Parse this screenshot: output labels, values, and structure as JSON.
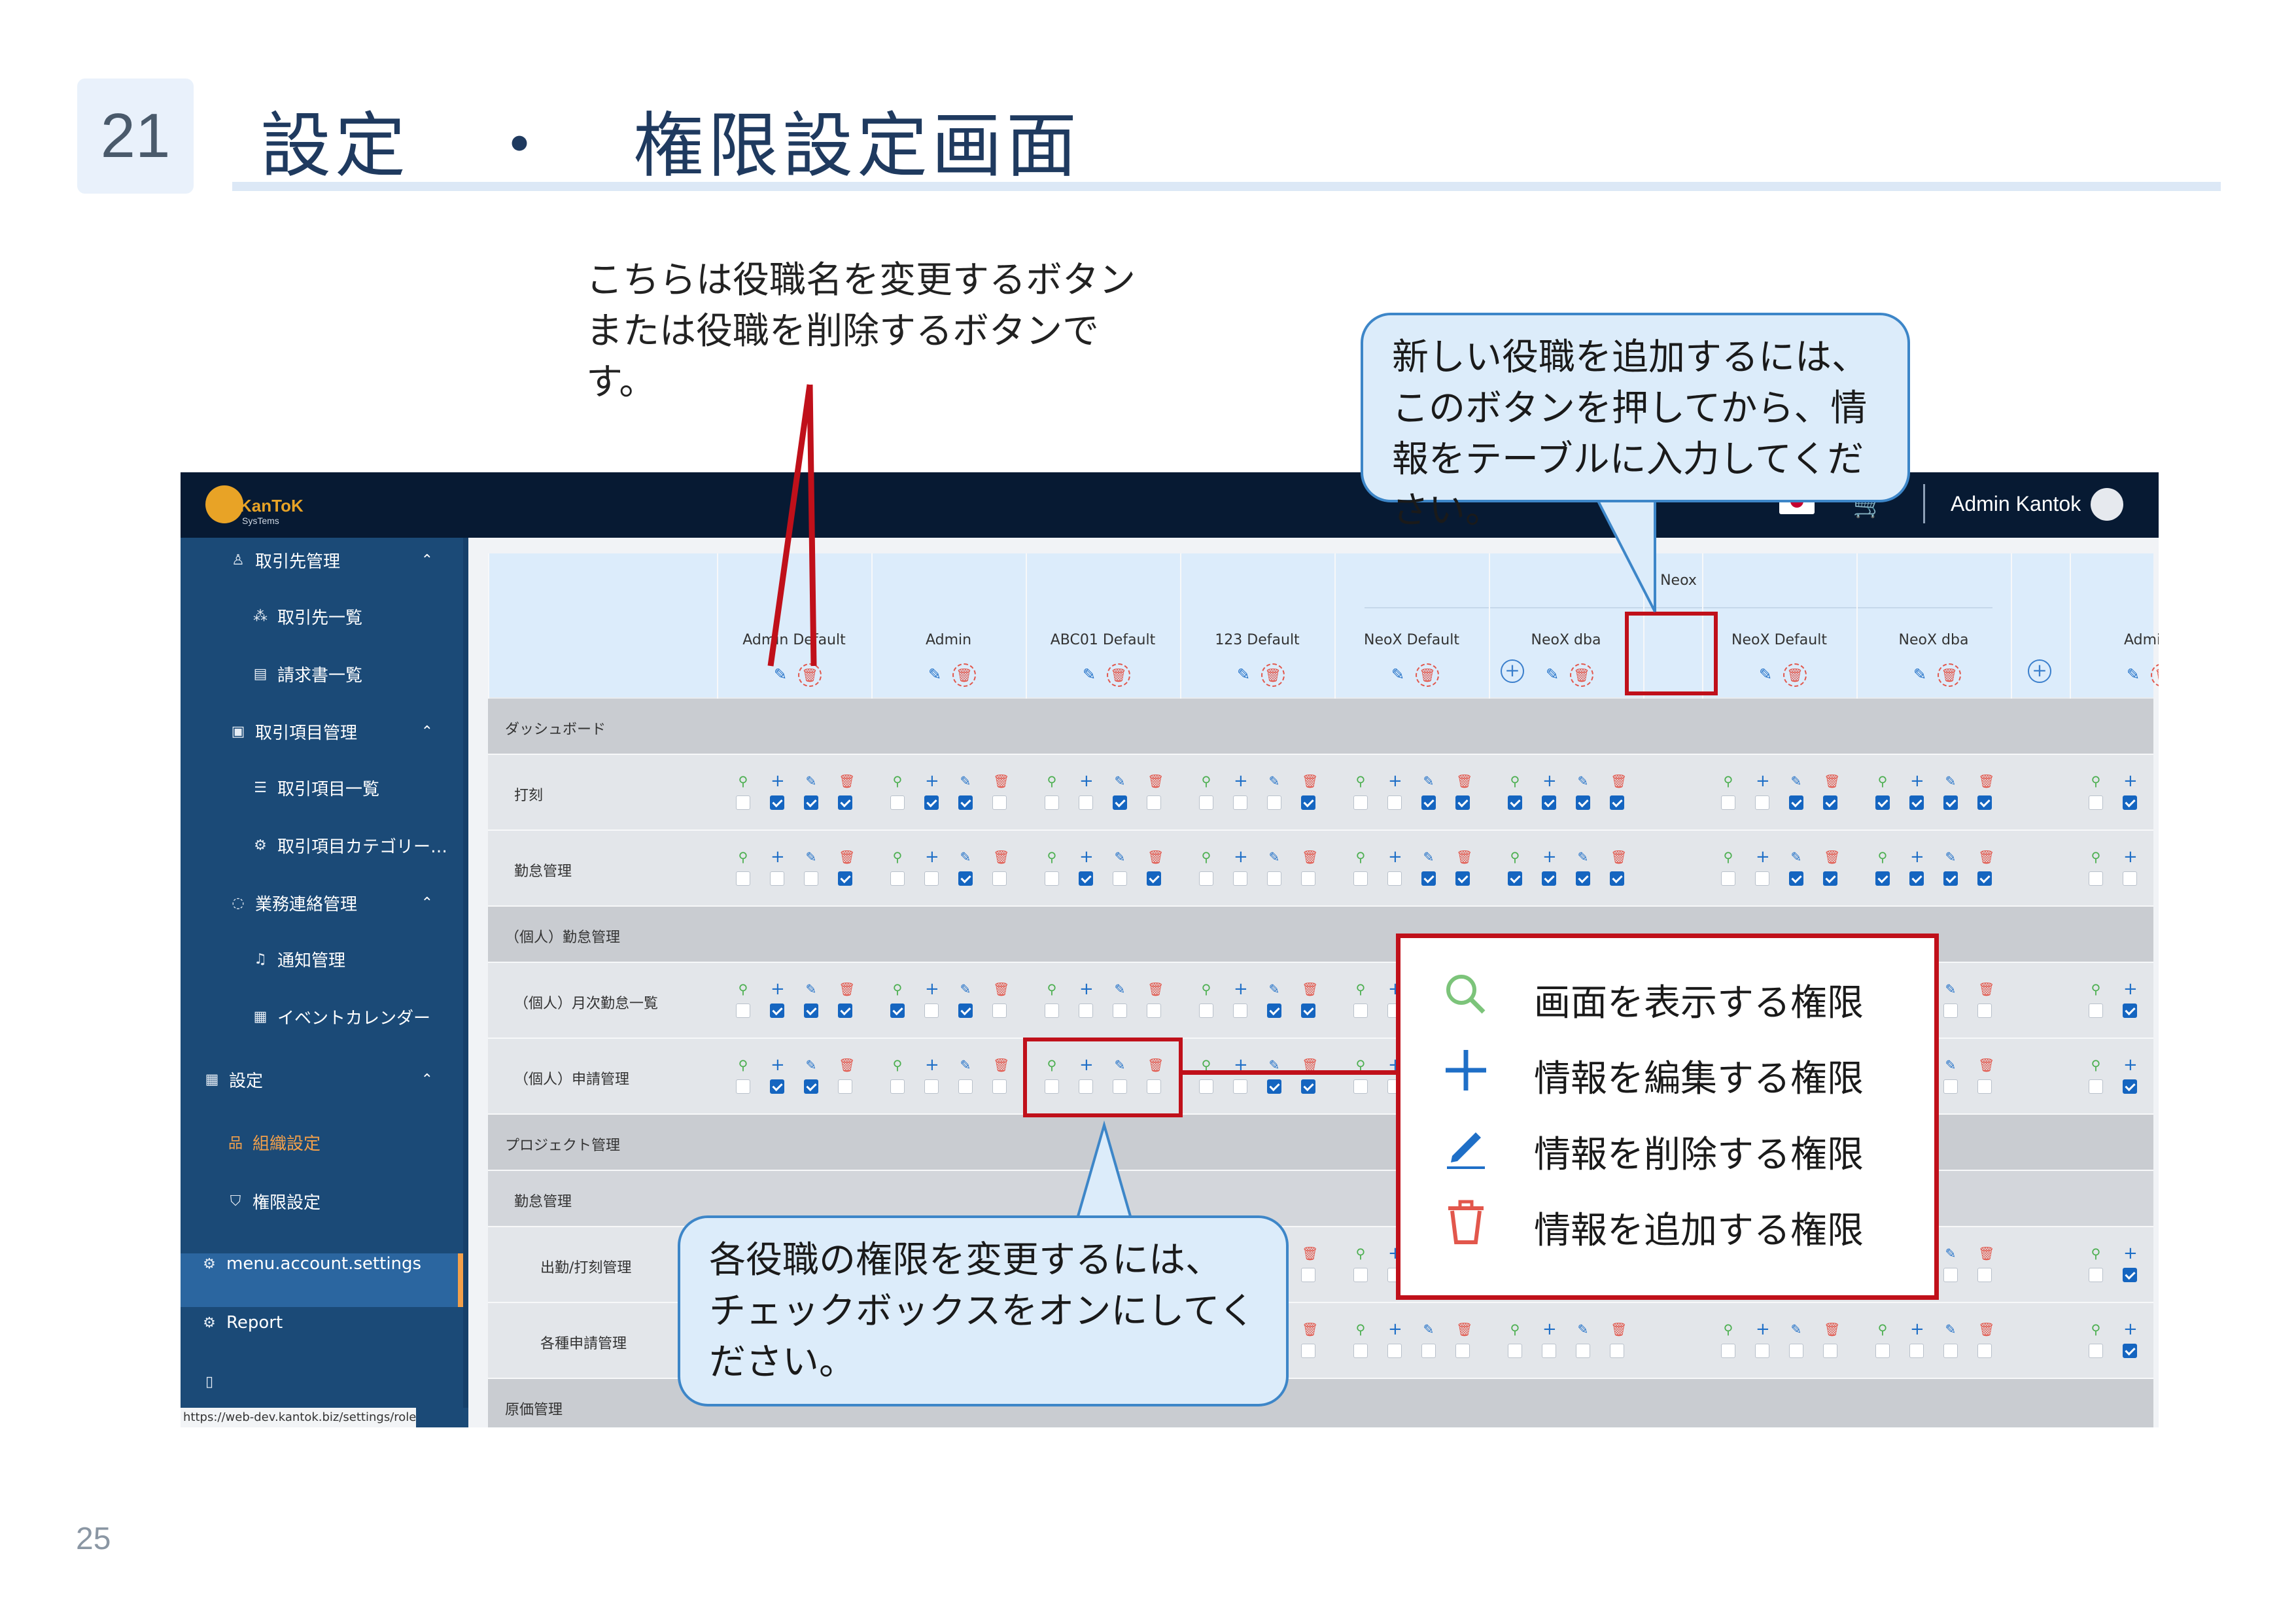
{
  "slide": {
    "section_number": "21",
    "title": "設定　・　権限設定画面",
    "page_number": "25"
  },
  "annotations": {
    "top_note": "こちらは役職名を変更するボタンまたは役職を削除するボタンです。",
    "add_role_callout": "新しい役職を追加するには、このボタンを押してから、情報をテーブルに入力してください。",
    "checkbox_callout": "各役職の権限を変更するには、チェックボックスをオンにしてください。",
    "legend": {
      "view_icon": "search-icon",
      "view_label": "画面を表示する権限",
      "add_icon": "plus-icon",
      "add_label": "情報を編集する権限",
      "edit_icon": "pencil-icon",
      "edit_label": "情報を削除する権限",
      "delete_icon": "trash-icon",
      "delete_label": "情報を追加する権限"
    },
    "highlight_color": "#c0101a"
  },
  "app": {
    "logo_text": "KanToK",
    "logo_subtext": "SysTems",
    "user_name": "Admin Kantok",
    "status_url": "https://web-dev.kantok.biz/settings/role#"
  },
  "sidebar": {
    "items": [
      {
        "label": "取引先管理",
        "icon": "people-icon"
      },
      {
        "label": "取引先一覧",
        "icon": "sitemap-icon"
      },
      {
        "label": "請求書一覧",
        "icon": "document-icon"
      },
      {
        "label": "取引項目管理",
        "icon": "box-icon"
      },
      {
        "label": "取引項目一覧",
        "icon": "list-icon"
      },
      {
        "label": "取引項目カテゴリー…",
        "icon": "gear-icon"
      },
      {
        "label": "業務連絡管理",
        "icon": "chat-icon"
      },
      {
        "label": "通知管理",
        "icon": "bell-icon"
      },
      {
        "label": "イベントカレンダー",
        "icon": "calendar-icon"
      },
      {
        "label": "設定",
        "icon": "calendar-icon"
      },
      {
        "label": "組織設定",
        "icon": "org-icon"
      },
      {
        "label": "権限設定",
        "icon": "shield-icon"
      },
      {
        "label": "menu.account.settings",
        "icon": "gear-icon"
      },
      {
        "label": "Report",
        "icon": "gear-icon"
      }
    ],
    "active_item": "権限設定",
    "highlight_item": "組織設定",
    "accent_color": "#f3a04a"
  },
  "table": {
    "group_header": "Neox",
    "roles": [
      "Admin Default",
      "Admin",
      "ABC01 Default",
      "123 Default",
      "NeoX Default",
      "NeoX dba",
      "NeoX Default",
      "NeoX dba",
      "Admin"
    ],
    "rows": [
      {
        "label": "ダッシュボード",
        "kind": "group"
      },
      {
        "label": "打刻",
        "kind": "perm",
        "checks": [
          [
            0,
            1,
            1,
            1
          ],
          [
            0,
            1,
            1,
            0
          ],
          [
            0,
            0,
            1,
            0
          ],
          [
            0,
            0,
            0,
            1
          ],
          [
            0,
            0,
            1,
            1
          ],
          [
            1,
            1,
            1,
            1
          ],
          [
            0,
            0,
            1,
            1
          ],
          [
            1,
            1,
            1,
            1
          ],
          [
            0,
            1
          ]
        ]
      },
      {
        "label": "勤怠管理",
        "kind": "perm",
        "checks": [
          [
            0,
            0,
            0,
            1
          ],
          [
            0,
            0,
            1,
            0
          ],
          [
            0,
            1,
            0,
            1
          ],
          [
            0,
            0,
            0,
            0
          ],
          [
            0,
            0,
            1,
            1
          ],
          [
            1,
            1,
            1,
            1
          ],
          [
            0,
            0,
            1,
            1
          ],
          [
            1,
            1,
            1,
            1
          ],
          [
            0,
            0
          ]
        ]
      },
      {
        "label": "（個人）勤怠管理",
        "kind": "group"
      },
      {
        "label": "（個人）月次勤怠一覧",
        "kind": "perm",
        "checks": [
          [
            0,
            1,
            1,
            1
          ],
          [
            1,
            0,
            1,
            0
          ],
          [
            0,
            0,
            0,
            0
          ],
          [
            0,
            0,
            1,
            1
          ],
          [
            0,
            0,
            0,
            0
          ],
          [
            0,
            0,
            0,
            0
          ],
          [
            0,
            0,
            0,
            0
          ],
          [
            0,
            0,
            0,
            0
          ],
          [
            0,
            1
          ]
        ]
      },
      {
        "label": "（個人）申請管理",
        "kind": "perm",
        "checks": [
          [
            0,
            1,
            1,
            0
          ],
          [
            0,
            0,
            0,
            0
          ],
          [
            0,
            0,
            0,
            0
          ],
          [
            0,
            0,
            1,
            1
          ],
          [
            0,
            0,
            0,
            0
          ],
          [
            0,
            0,
            0,
            0
          ],
          [
            0,
            0,
            0,
            0
          ],
          [
            0,
            0,
            0,
            0
          ],
          [
            0,
            1
          ]
        ]
      },
      {
        "label": "プロジェクト管理",
        "kind": "group"
      },
      {
        "label": "勤怠管理",
        "kind": "sub"
      },
      {
        "label": "出勤/打刻管理",
        "kind": "perm",
        "checks": [
          [
            0,
            0,
            0,
            0
          ],
          [
            0,
            0,
            0,
            0
          ],
          [
            0,
            0,
            0,
            0
          ],
          [
            0,
            0,
            0,
            0
          ],
          [
            0,
            0,
            0,
            0
          ],
          [
            0,
            0,
            0,
            0
          ],
          [
            0,
            0,
            0,
            0
          ],
          [
            0,
            0,
            0,
            0
          ],
          [
            0,
            1
          ]
        ]
      },
      {
        "label": "各種申請管理",
        "kind": "perm",
        "checks": [
          [
            0,
            0,
            0,
            0
          ],
          [
            0,
            0,
            0,
            0
          ],
          [
            0,
            0,
            0,
            0
          ],
          [
            0,
            0,
            0,
            0
          ],
          [
            0,
            0,
            0,
            0
          ],
          [
            0,
            0,
            0,
            0
          ],
          [
            0,
            0,
            0,
            0
          ],
          [
            0,
            0,
            0,
            0
          ],
          [
            0,
            1
          ]
        ]
      },
      {
        "label": "原価管理",
        "kind": "group"
      }
    ]
  }
}
